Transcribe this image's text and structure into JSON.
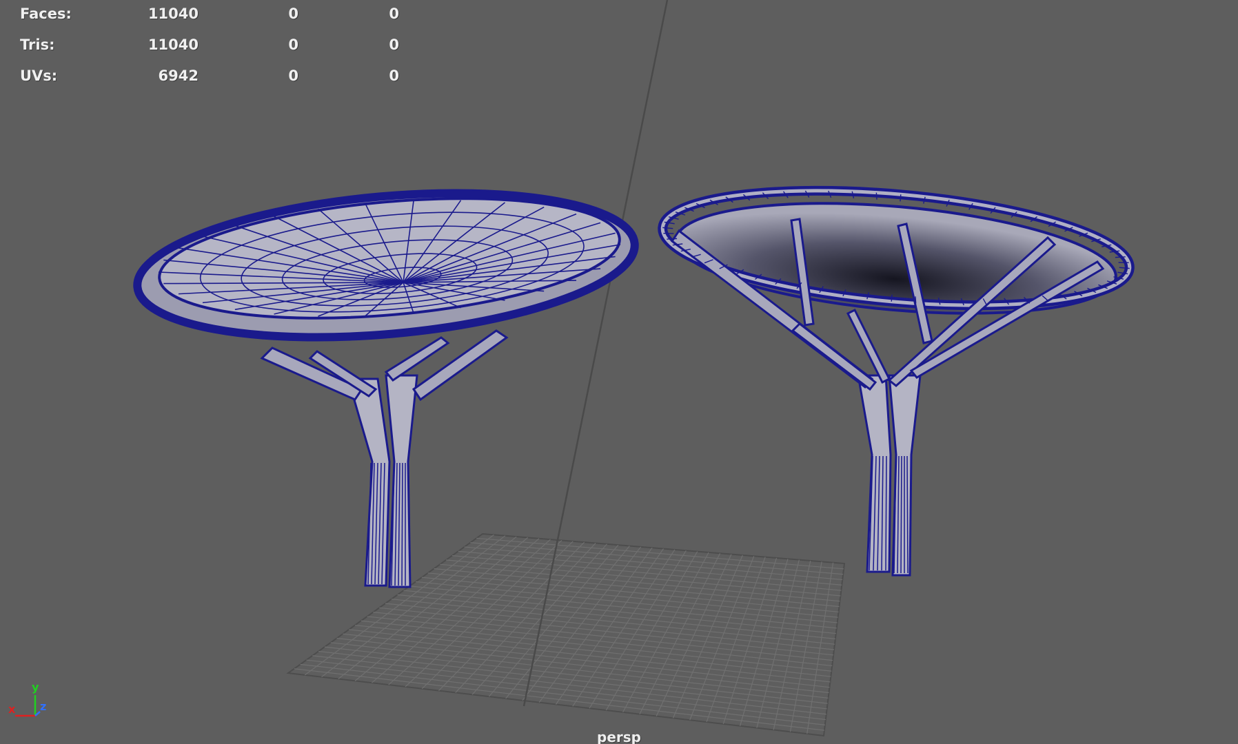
{
  "hud": {
    "rows": [
      {
        "label": "Faces:",
        "v1": "11040",
        "v2": "0",
        "v3": "0"
      },
      {
        "label": "Tris:",
        "v1": "11040",
        "v2": "0",
        "v3": "0"
      },
      {
        "label": "UVs:",
        "v1": "6942",
        "v2": "0",
        "v3": "0"
      }
    ]
  },
  "viewport": {
    "camera_label": "persp",
    "background": "#5e5e5e",
    "wire_color": "#1a1a8c",
    "surface_color": "#b9b9c8",
    "grid_color": "#6e6e6e"
  },
  "axis_indicator": {
    "x_label": "x",
    "y_label": "y",
    "z_label": "z",
    "x_color": "#e02020",
    "y_color": "#20d020",
    "z_color": "#3070ff"
  }
}
